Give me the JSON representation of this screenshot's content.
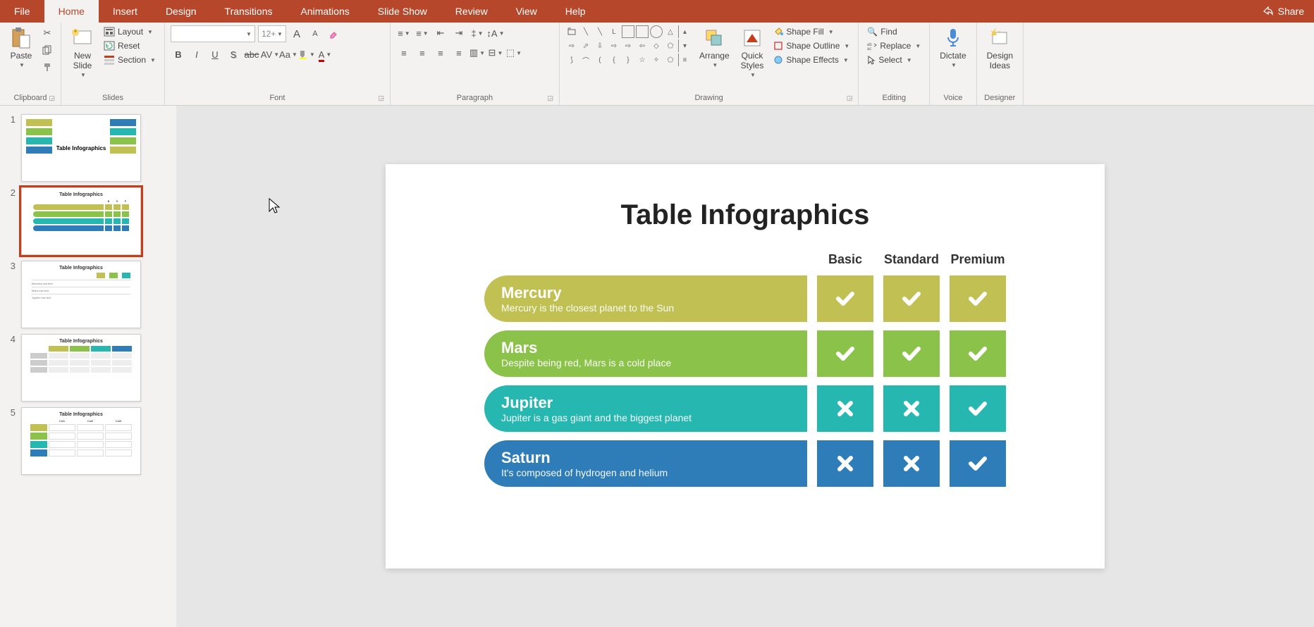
{
  "tabs": [
    "File",
    "Home",
    "Insert",
    "Design",
    "Transitions",
    "Animations",
    "Slide Show",
    "Review",
    "View",
    "Help"
  ],
  "active_tab": "Home",
  "share": "Share",
  "ribbon": {
    "clipboard": {
      "label": "Clipboard",
      "paste": "Paste"
    },
    "slides": {
      "label": "Slides",
      "new_slide": "New\nSlide",
      "layout": "Layout",
      "reset": "Reset",
      "section": "Section"
    },
    "font": {
      "label": "Font",
      "size": "12+"
    },
    "paragraph": {
      "label": "Paragraph"
    },
    "drawing": {
      "label": "Drawing",
      "arrange": "Arrange",
      "quick_styles": "Quick\nStyles",
      "shape_fill": "Shape Fill",
      "shape_outline": "Shape Outline",
      "shape_effects": "Shape Effects"
    },
    "editing": {
      "label": "Editing",
      "find": "Find",
      "replace": "Replace",
      "select": "Select"
    },
    "voice": {
      "label": "Voice",
      "dictate": "Dictate"
    },
    "designer": {
      "label": "Designer",
      "design_ideas": "Design\nIdeas"
    }
  },
  "thumbnails": [
    {
      "num": "1",
      "title": "Table\nInfographics"
    },
    {
      "num": "2",
      "title": "Table Infographics",
      "selected": true
    },
    {
      "num": "3",
      "title": "Table Infographics"
    },
    {
      "num": "4",
      "title": "Table Infographics"
    },
    {
      "num": "5",
      "title": "Table Infographics"
    }
  ],
  "slide": {
    "title": "Table Infographics",
    "columns": [
      "Basic",
      "Standard",
      "Premium"
    ],
    "rows": [
      {
        "name": "Mercury",
        "desc": "Mercury is the closest planet to the Sun",
        "color": "c-olive",
        "cells": [
          "check",
          "check",
          "check"
        ]
      },
      {
        "name": "Mars",
        "desc": "Despite being red, Mars is a cold place",
        "color": "c-green",
        "cells": [
          "check",
          "check",
          "check"
        ]
      },
      {
        "name": "Jupiter",
        "desc": "Jupiter is a gas giant and the biggest planet",
        "color": "c-teal",
        "cells": [
          "cross",
          "cross",
          "check"
        ]
      },
      {
        "name": "Saturn",
        "desc": "It's composed of hydrogen and helium",
        "color": "c-blue",
        "cells": [
          "cross",
          "cross",
          "check"
        ]
      }
    ]
  }
}
